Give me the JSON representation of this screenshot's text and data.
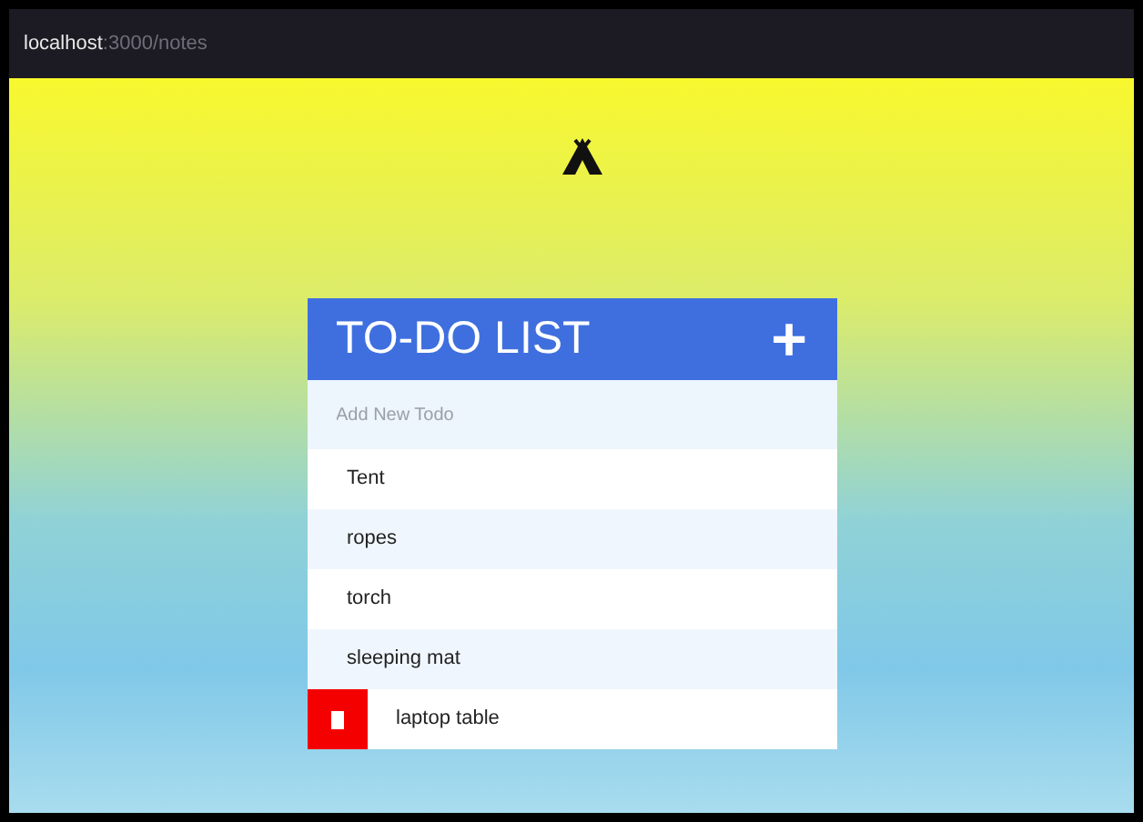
{
  "address_bar": {
    "host": "localhost",
    "path": ":3000/notes"
  },
  "todo": {
    "title": "TO-DO LIST",
    "add_button": "+",
    "input": {
      "placeholder": "Add New Todo"
    },
    "items": [
      {
        "text": "Tent",
        "delete_shown": false
      },
      {
        "text": "ropes",
        "delete_shown": false
      },
      {
        "text": "torch",
        "delete_shown": false
      },
      {
        "text": "sleeping mat",
        "delete_shown": false
      },
      {
        "text": "laptop table",
        "delete_shown": true
      }
    ]
  }
}
